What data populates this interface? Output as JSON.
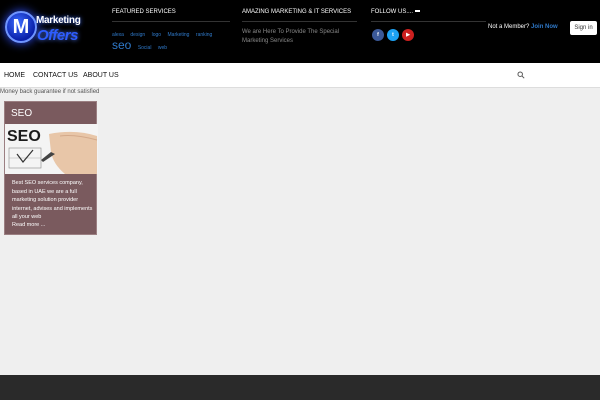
{
  "logo": {
    "letter": "M",
    "line1": "Marketing",
    "line2": "Offers"
  },
  "header": {
    "featured": {
      "heading": "FEATURED SERVICES",
      "tags": [
        {
          "text": "alexa",
          "size": "small"
        },
        {
          "text": "design",
          "size": "small"
        },
        {
          "text": "logo",
          "size": "small"
        },
        {
          "text": "Marketing",
          "size": "small"
        },
        {
          "text": "ranking",
          "size": "small"
        },
        {
          "text": "seo",
          "size": "big"
        },
        {
          "text": "Social",
          "size": "small"
        },
        {
          "text": "web",
          "size": "small"
        }
      ]
    },
    "amazing": {
      "heading": "AMAZING MARKETING & IT SERVICES",
      "text": "We are Here To Provide The Special Marketing Services"
    },
    "follow": {
      "heading": "FOLLOW US....",
      "icons": [
        {
          "name": "facebook-icon",
          "glyph": "f",
          "color": "#3b5998"
        },
        {
          "name": "twitter-icon",
          "glyph": "t",
          "color": "#1da1f2"
        },
        {
          "name": "youtube-icon",
          "glyph": "▶",
          "color": "#cd201f"
        }
      ]
    },
    "member": {
      "prompt": "Not a Member?",
      "join": "Join Now",
      "signin": "Sign in"
    }
  },
  "nav": {
    "items": [
      "HOME",
      "CONTACT US",
      "ABOUT US"
    ]
  },
  "subtitle": "Money back guarantee if not satisfied",
  "card": {
    "title": "SEO",
    "image_text": "SEO",
    "text": "Best SEO services company, based in UAE we are a full marketing solution provider internet, advises and implements all your web",
    "more": "Read more ..."
  },
  "colors": {
    "accent": "#2f79c9",
    "card": "#7a5a5e",
    "topbar": "#000000",
    "footer": "#2a2a2a"
  }
}
